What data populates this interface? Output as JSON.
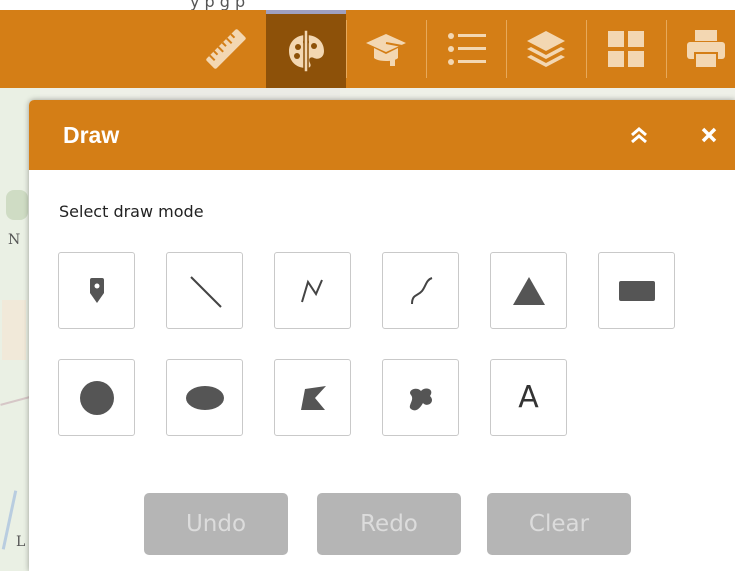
{
  "top_fragment": "y                                    p g  p",
  "map": {
    "letter_n": "N",
    "letter_l": "L"
  },
  "toolbar": {
    "buttons": [
      {
        "icon": "ruler-icon",
        "active": false
      },
      {
        "icon": "palette-draw-icon",
        "active": true
      },
      {
        "icon": "graduation-cap-icon",
        "active": false
      },
      {
        "icon": "list-icon",
        "active": false
      },
      {
        "icon": "layers-icon",
        "active": false
      },
      {
        "icon": "grid-icon",
        "active": false
      },
      {
        "icon": "printer-icon",
        "active": false
      }
    ]
  },
  "panel": {
    "title": "Draw",
    "collapse_icon": "double-chevron-up-icon",
    "close_icon": "close-icon",
    "mode_label": "Select draw mode",
    "modes": [
      {
        "name": "point",
        "icon": "map-pin-icon"
      },
      {
        "name": "line",
        "icon": "line-icon"
      },
      {
        "name": "polyline",
        "icon": "polyline-icon"
      },
      {
        "name": "freehand-polyline",
        "icon": "freehand-line-icon"
      },
      {
        "name": "triangle",
        "icon": "triangle-icon"
      },
      {
        "name": "rectangle",
        "icon": "rectangle-icon"
      },
      {
        "name": "circle",
        "icon": "circle-icon"
      },
      {
        "name": "ellipse",
        "icon": "ellipse-icon"
      },
      {
        "name": "polygon",
        "icon": "polygon-icon"
      },
      {
        "name": "freehand-polygon",
        "icon": "freehand-polygon-icon"
      },
      {
        "name": "text",
        "icon": "text-icon",
        "label": "A"
      }
    ],
    "actions": {
      "undo": "Undo",
      "redo": "Redo",
      "clear": "Clear"
    }
  },
  "colors": {
    "accent": "#d47e16",
    "active_tool": "#8d5109",
    "icon_fill": "#555555",
    "disabled_button": "#b5b5b5"
  }
}
